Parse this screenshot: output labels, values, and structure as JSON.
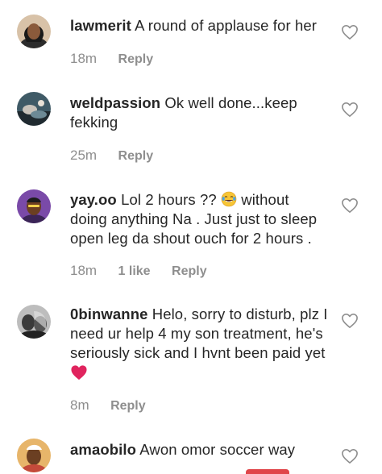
{
  "comments": [
    {
      "username": "lawmerit",
      "text": "A round of applause for her",
      "time": "18m",
      "reply_label": "Reply",
      "avatar_icon": "profile-photo"
    },
    {
      "username": "weldpassion",
      "text": "Ok well done...keep fekking",
      "time": "25m",
      "reply_label": "Reply",
      "avatar_icon": "profile-photo"
    },
    {
      "username": "yay.oo",
      "text_before_emoji": "Lol 2 hours ??",
      "emoji": "face-with-tears-of-joy",
      "text_after_emoji": "without doing anything Na . Just just to sleep open leg da shout ouch for 2 hours .",
      "time": "18m",
      "likes_label": "1 like",
      "reply_label": "Reply",
      "avatar_icon": "profile-photo"
    },
    {
      "username": "0binwanne",
      "text": "Helo, sorry to disturb, plz I need ur help 4 my son treatment, he's seriously sick and I hvnt been paid yet",
      "emoji": "red-heart",
      "time": "8m",
      "reply_label": "Reply",
      "avatar_icon": "profile-photo"
    },
    {
      "username": "amaobilo",
      "text": "Awon omor soccer way",
      "avatar_icon": "profile-photo"
    }
  ],
  "icons": {
    "like": "heart-outline-icon"
  },
  "colors": {
    "text": "#262626",
    "meta": "#8e8e8e",
    "heart_emoji": "#e0245e"
  }
}
